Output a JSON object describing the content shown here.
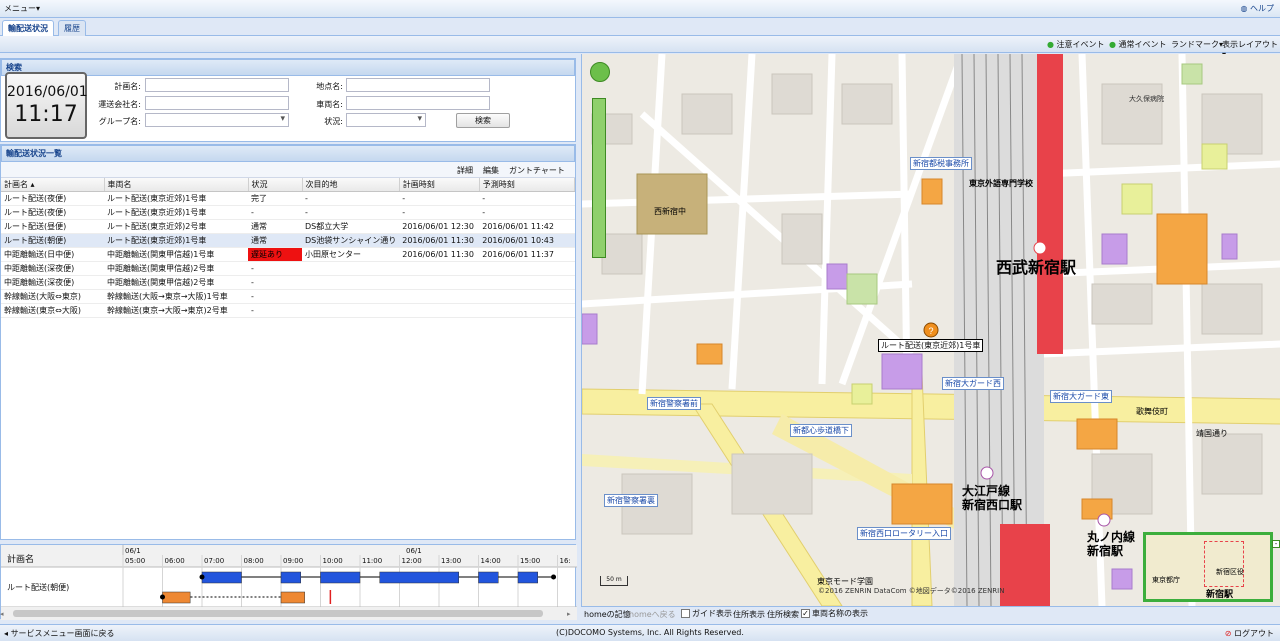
{
  "menubar": {
    "menu_label": "メニュー▾",
    "help_label": "ヘルプ"
  },
  "tabs": [
    {
      "label": "輸配送状況"
    },
    {
      "label": "履歴"
    }
  ],
  "map_toolbar": {
    "caution_event": "注意イベント",
    "normal_event": "通常イベント",
    "landmark": "ランドマーク▾",
    "layout": "表示レイアウト▾"
  },
  "search": {
    "title": "検索",
    "date": "2016/06/01",
    "time": "11:17",
    "plan_name_label": "計画名:",
    "carrier_label": "運送会社名:",
    "group_label": "グループ名:",
    "location_label": "地点名:",
    "vehicle_label": "車両名:",
    "status_label": "状況:",
    "search_button": "検索"
  },
  "list": {
    "title": "輸配送状況一覧",
    "actions": {
      "detail": "詳細",
      "edit": "編集",
      "gantt": "ガントチャート"
    },
    "columns": [
      "計画名",
      "車両名",
      "状況",
      "次目的地",
      "計画時刻",
      "予測時刻"
    ],
    "rows": [
      [
        "ルート配送(夜便)",
        "ルート配送(東京近郊)1号車",
        "完了",
        "-",
        "-",
        "-"
      ],
      [
        "ルート配送(夜便)",
        "ルート配送(東京近郊)1号車",
        "-",
        "-",
        "-",
        "-"
      ],
      [
        "ルート配送(昼便)",
        "ルート配送(東京近郊)2号車",
        "通常",
        "DS都立大学",
        "2016/06/01 12:30",
        "2016/06/01 11:42"
      ],
      [
        "ルート配送(朝便)",
        "ルート配送(東京近郊)1号車",
        "通常",
        "DS池袋サンシャイン通り",
        "2016/06/01 11:30",
        "2016/06/01 10:43"
      ],
      [
        "中距離輸送(日中便)",
        "中距離輸送(関東甲信越)1号車",
        "遅延あり",
        "小田原センター",
        "2016/06/01 11:30",
        "2016/06/01 11:37"
      ],
      [
        "中距離輸送(深夜便)",
        "中距離輸送(関東甲信越)2号車",
        "-",
        "",
        "",
        ""
      ],
      [
        "中距離輸送(深夜便)",
        "中距離輸送(関東甲信越)2号車",
        "-",
        "",
        "",
        ""
      ],
      [
        "幹線輸送(大阪⇔東京)",
        "幹線輸送(大阪→東京→大阪)1号車",
        "-",
        "",
        "",
        ""
      ],
      [
        "幹線輸送(東京⇔大阪)",
        "幹線輸送(東京→大阪→東京)2号車",
        "-",
        "",
        "",
        ""
      ]
    ]
  },
  "gantt": {
    "plan_header": "計画名",
    "row_label": "ルート配送(朝便)",
    "date_marks": [
      "06/1",
      "06/1"
    ],
    "hours": [
      "05:00",
      "06:00",
      "07:00",
      "08:00",
      "09:00",
      "10:00",
      "11:00",
      "12:00",
      "13:00",
      "14:00",
      "15:00",
      "16:"
    ]
  },
  "map": {
    "vehicle_label": "ルート配送(東京近郊)1号車",
    "station_big": "西武新宿駅",
    "station2a": "大江戸線",
    "station2b": "新宿西口駅",
    "station3a": "丸ノ内線",
    "station3b": "新宿駅",
    "school": "西新宿中",
    "school2": "東京外語専門学校",
    "tax": "新宿都税事務所",
    "road1": "新宿大ガード西",
    "road2": "新宿大ガード東",
    "road3": "新都心歩道橋下",
    "road4": "新宿警察署前",
    "road5": "新宿警察署裏",
    "road6": "新宿西口ロータリー入口",
    "road7": "歌舞伎町",
    "road8": "靖国通り",
    "hospital": "大久保病院",
    "mode": "東京モード学園",
    "copyright": "©2016 ZENRIN DataCom ©地図データ©2016 ZENRIN",
    "scale": "50 m",
    "overview_labels": [
      "東京都庁",
      "新宿区役",
      "新宿駅"
    ]
  },
  "map_footer": {
    "home_label": "homeの記憶",
    "home_back": "homeへ戻る",
    "guide": "ガイド表示",
    "addr_show": "住所表示",
    "addr_search": "住所検索",
    "vehicle_names": "車両名称の表示"
  },
  "footer": {
    "back": "サービスメニュー画面に戻る",
    "copyright": "(C)DOCOMO Systems, Inc. All Rights Reserved.",
    "logout": "ログアウト"
  },
  "colors": {
    "late": "#ee1111",
    "gantt_blue": "#2255dd",
    "gantt_orange": "#ee8833",
    "rail_red": "#e8424a"
  }
}
